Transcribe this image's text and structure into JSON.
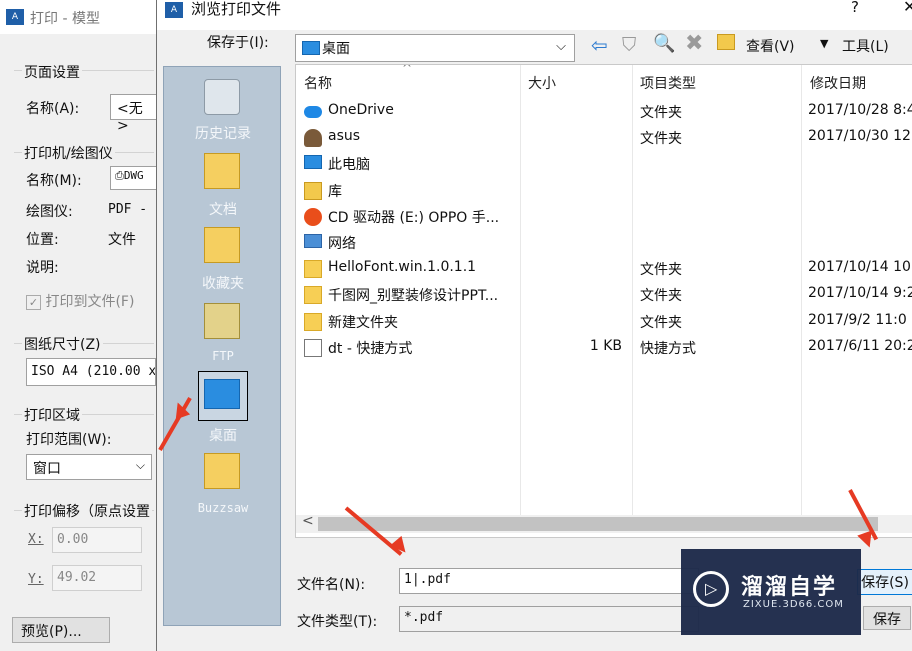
{
  "background_window": {
    "title": "打印 - 模型",
    "page_setup": {
      "group": "页面设置",
      "name_label": "名称(A):",
      "name_value": "<无>"
    },
    "printer": {
      "group": "打印机/绘图仪",
      "name_label": "名称(M):",
      "name_value": "DWG",
      "plotter_label": "绘图仪:",
      "plotter_value": "PDF -",
      "location_label": "位置:",
      "location_value": "文件",
      "desc_label": "说明:",
      "print_to_file": "打印到文件(F)"
    },
    "paper": {
      "group": "图纸尺寸(Z)",
      "value": "ISO A4 (210.00 x"
    },
    "area": {
      "group": "打印区域",
      "range_label": "打印范围(W):",
      "range_value": "窗口"
    },
    "offset": {
      "group": "打印偏移（原点设置",
      "x_label": "X:",
      "x_value": "0.00",
      "y_label": "Y:",
      "y_value": "49.02"
    },
    "preview_button": "预览(P)..."
  },
  "dialog": {
    "title": "浏览打印文件",
    "help": "?",
    "close": "✕",
    "save_in_label": "保存于(I):",
    "save_in_value": "桌面",
    "view_label": "查看(V)",
    "tools_label": "工具(L)",
    "places": [
      "历史记录",
      "文档",
      "收藏夹",
      "FTP",
      "桌面",
      "Buzzsaw"
    ],
    "columns": {
      "name": "名称",
      "size": "大小",
      "type": "项目类型",
      "date": "修改日期"
    },
    "files": [
      {
        "icon": "onedrive-icon",
        "name": "OneDrive",
        "size": "",
        "type": "文件夹",
        "date": "2017/10/28 8:4"
      },
      {
        "icon": "user-icon",
        "name": "asus",
        "size": "",
        "type": "文件夹",
        "date": "2017/10/30 12"
      },
      {
        "icon": "computer-icon",
        "name": "此电脑",
        "size": "",
        "type": "",
        "date": ""
      },
      {
        "icon": "library-icon",
        "name": "库",
        "size": "",
        "type": "",
        "date": ""
      },
      {
        "icon": "cd-drive-icon",
        "name": "CD 驱动器 (E:) OPPO 手...",
        "size": "",
        "type": "",
        "date": ""
      },
      {
        "icon": "network-icon",
        "name": "网络",
        "size": "",
        "type": "",
        "date": ""
      },
      {
        "icon": "folder-icon",
        "name": "HelloFont.win.1.0.1.1",
        "size": "",
        "type": "文件夹",
        "date": "2017/10/14 10"
      },
      {
        "icon": "folder-icon",
        "name": "千图网_别墅装修设计PPT...",
        "size": "",
        "type": "文件夹",
        "date": "2017/10/14 9:2"
      },
      {
        "icon": "folder-icon",
        "name": "新建文件夹",
        "size": "",
        "type": "文件夹",
        "date": "2017/9/2 11:0"
      },
      {
        "icon": "shortcut-icon",
        "name": "dt - 快捷方式",
        "size": "1 KB",
        "type": "快捷方式",
        "date": "2017/6/11 20:2"
      }
    ],
    "filename_label": "文件名(N):",
    "filename_value": "1|.pdf",
    "filetype_label": "文件类型(T):",
    "filetype_value": "*.pdf",
    "save_button": "保存(S)",
    "save_button_2": "保存"
  },
  "watermark": {
    "brand": "溜溜自学",
    "url": "ZIXUE.3D66.COM"
  },
  "colors": {
    "annotation_arrow": "#e63a23",
    "places_panel": "#b8c7d5",
    "watermark_bg": "#1d2a4a"
  }
}
